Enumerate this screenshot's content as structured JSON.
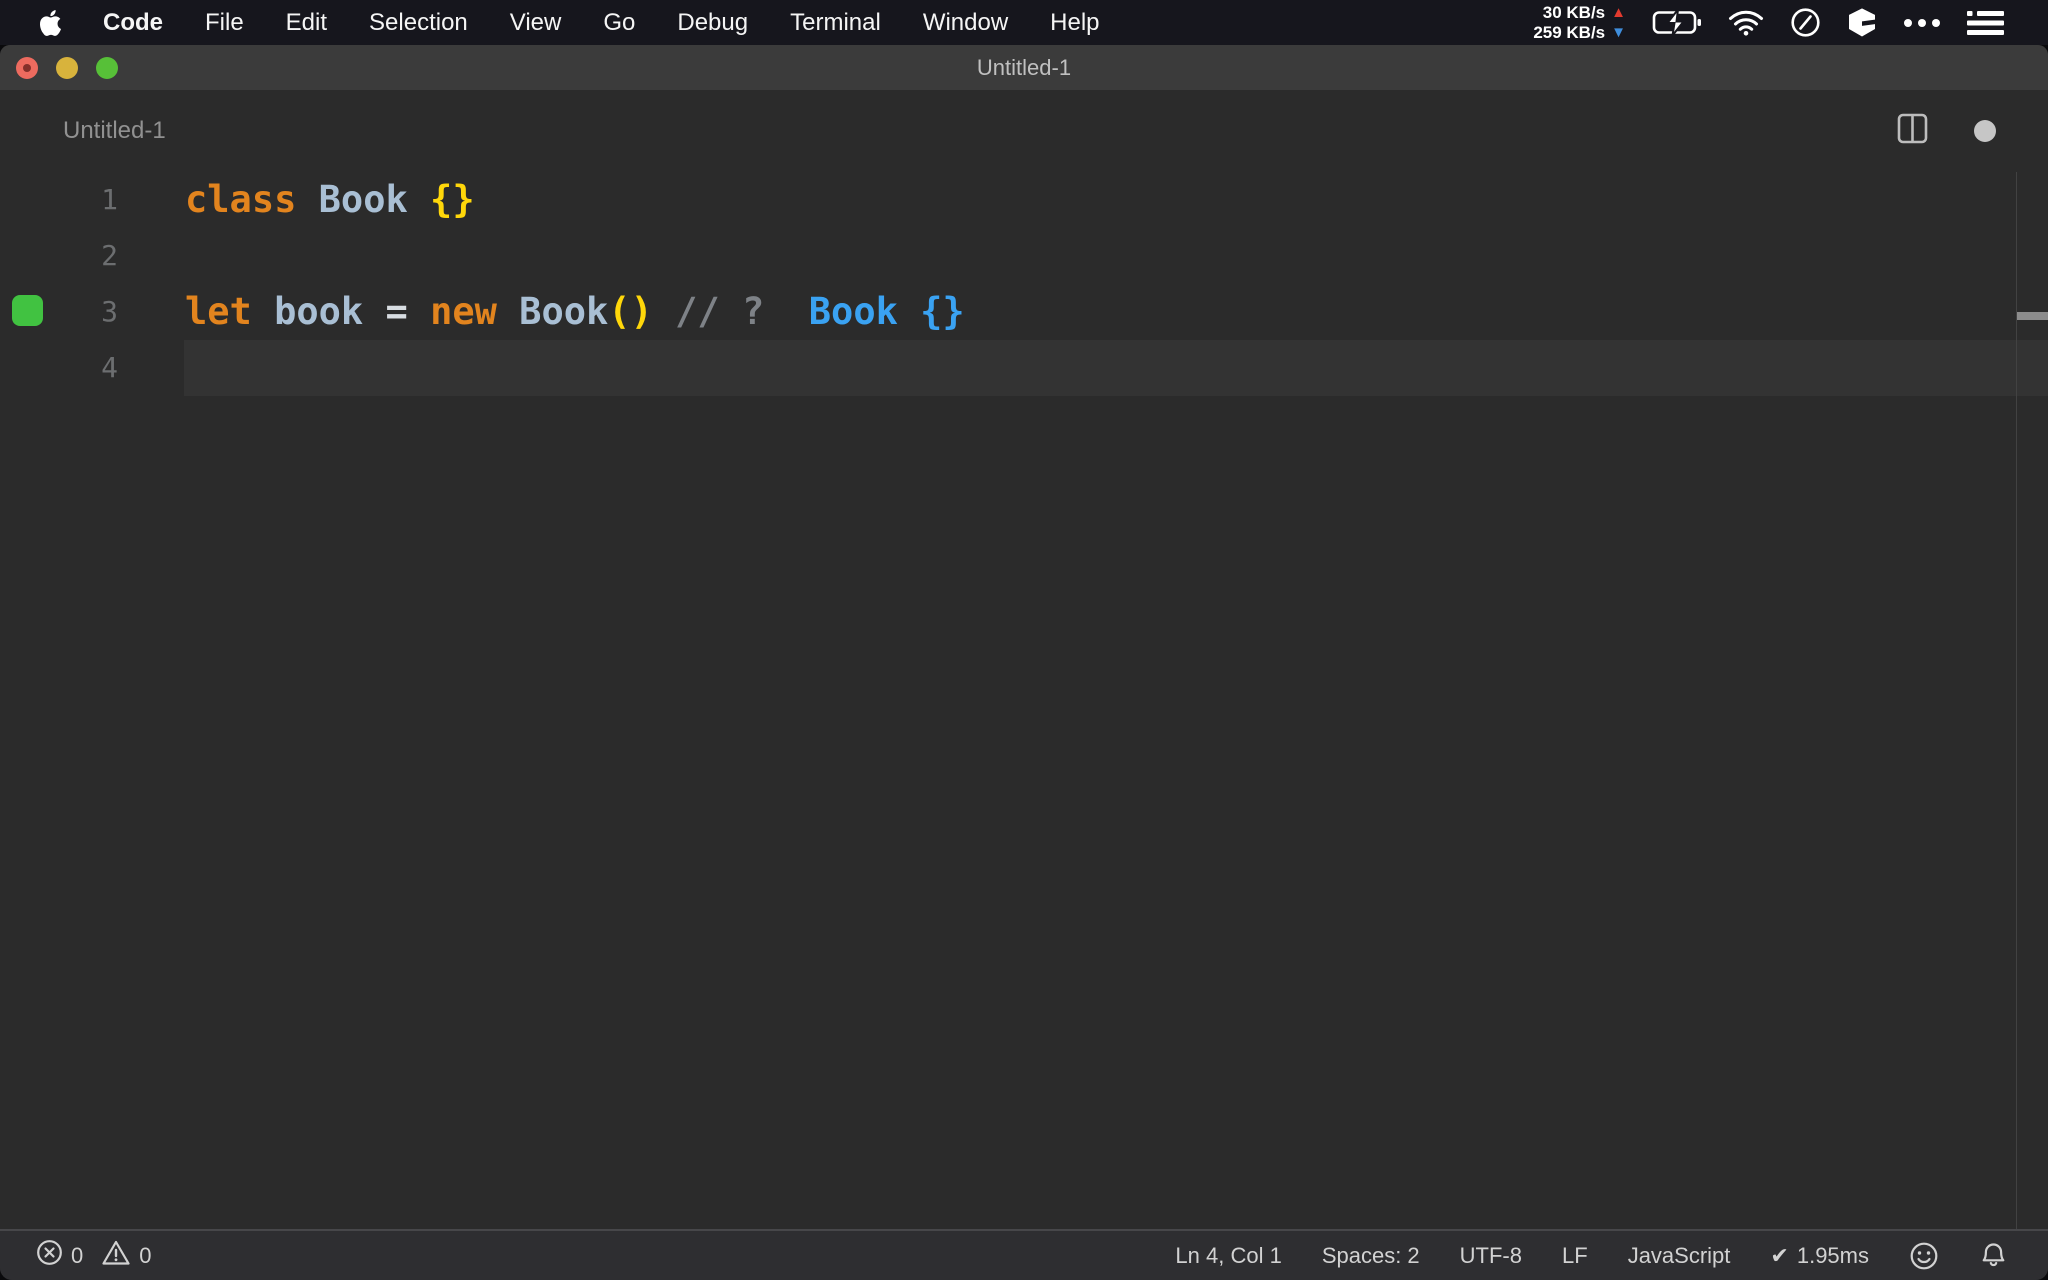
{
  "menubar": {
    "app_menu": "Code",
    "items": [
      "File",
      "Edit",
      "Selection",
      "View",
      "Go",
      "Debug",
      "Terminal",
      "Window",
      "Help"
    ],
    "network": {
      "up": "30 KB/s",
      "down": "259 KB/s",
      "up_arrow": "▲",
      "down_arrow": "▼"
    }
  },
  "titlebar": {
    "title": "Untitled-1"
  },
  "editor_header": {
    "title": "Untitled-1"
  },
  "code": {
    "line1": {
      "num": "1",
      "t_class": "class ",
      "t_name": "Book ",
      "t_braces": "{}"
    },
    "line2": {
      "num": "2"
    },
    "line3": {
      "num": "3",
      "t_let": "let ",
      "t_var": "book ",
      "t_eq": "= ",
      "t_new": "new ",
      "t_type": "Book",
      "t_parens": "() ",
      "t_comment": "// ",
      "t_q": "?  ",
      "t_result": "Book {}"
    },
    "line4": {
      "num": "4"
    }
  },
  "statusbar": {
    "errors": "0",
    "warnings": "0",
    "cursor_position": "Ln 4, Col 1",
    "indentation": "Spaces: 2",
    "encoding": "UTF-8",
    "eol": "LF",
    "language": "JavaScript",
    "check": "✔",
    "exec_time": "1.95ms"
  },
  "colors": {
    "keyword": "#e2841e",
    "identifier": "#a9bfd4",
    "brace": "#ffd70a",
    "operator": "#d8dde2",
    "comment": "#7e8287",
    "quokka_result": "#3aa2f2",
    "quokka_marker": "#41c241",
    "menubar_bg": "#16161d",
    "titlebar_bg": "#3b3b3b",
    "editor_bg": "#2b2b2b",
    "statusbar_bg": "#2e2e31"
  }
}
